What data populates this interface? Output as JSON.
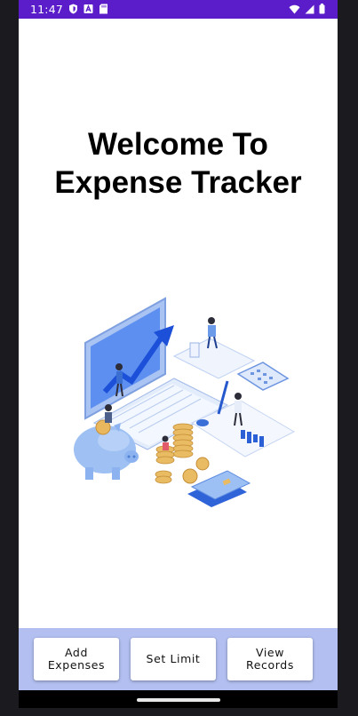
{
  "status_bar": {
    "time": "11:47",
    "icons_left": [
      "shield-icon",
      "a-badge-icon",
      "sd-card-icon"
    ],
    "icons_right": [
      "wifi-icon",
      "cellular-icon",
      "battery-icon"
    ],
    "background": "#5b1dc9"
  },
  "main": {
    "title_line1": "Welcome To",
    "title_line2": "Expense Tracker",
    "illustration": "finance-illustration"
  },
  "actions": {
    "add_label": "Add\nExpenses",
    "limit_label": "Set Limit",
    "view_label": "View\nRecords",
    "bar_color": "#b2bff0"
  }
}
